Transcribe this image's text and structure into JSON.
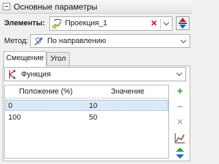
{
  "header": {
    "title": "Основные параметры"
  },
  "elements": {
    "label": "Элементы:",
    "value": "Проекция_1"
  },
  "method": {
    "label": "Метод:",
    "value": "По направлению"
  },
  "tabs": [
    {
      "label": "Смещение",
      "active": true
    },
    {
      "label": "Угол",
      "active": false
    }
  ],
  "function_select": {
    "value": "Функция"
  },
  "table": {
    "columns": [
      "Положение (%)",
      "Значение"
    ],
    "rows": [
      {
        "position": "0",
        "value": "10",
        "selected": true
      },
      {
        "position": "100",
        "value": "50",
        "selected": false
      }
    ]
  },
  "side_buttons": {
    "add": "+",
    "remove": "−",
    "clear": "×"
  },
  "colors": {
    "accent_red": "#c8102e",
    "add_green": "#2e9e34",
    "selection": "#dde9f7"
  }
}
